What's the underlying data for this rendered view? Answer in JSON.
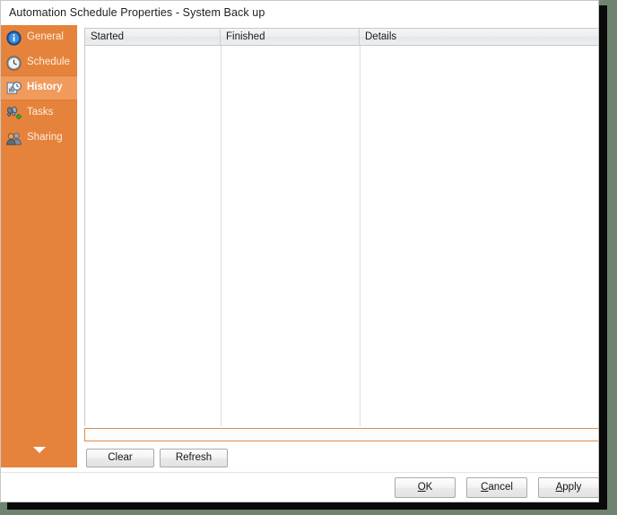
{
  "window": {
    "title": "Automation Schedule Properties - System Back up"
  },
  "sidebar": {
    "expander_icon": "chevron-down-icon",
    "items": [
      {
        "label": "General",
        "icon": "info-icon",
        "active": false
      },
      {
        "label": "Schedule",
        "icon": "clock-icon",
        "active": false
      },
      {
        "label": "History",
        "icon": "history-icon",
        "active": true
      },
      {
        "label": "Tasks",
        "icon": "tasks-icon",
        "active": false
      },
      {
        "label": "Sharing",
        "icon": "sharing-icon",
        "active": false
      }
    ]
  },
  "history_list": {
    "columns": [
      {
        "label": "Started"
      },
      {
        "label": "Finished"
      },
      {
        "label": "Details"
      }
    ],
    "rows": []
  },
  "actions": {
    "clear_label": "Clear",
    "refresh_label": "Refresh"
  },
  "footer": {
    "ok": {
      "accel": "O",
      "rest": "K"
    },
    "cancel": {
      "accel": "C",
      "rest": "ancel"
    },
    "apply": {
      "accel": "A",
      "rest": "pply"
    }
  },
  "colors": {
    "sidebar": "#e5833c",
    "sidebar_active": "#f09a5c",
    "sidebar_active_border": "#d97a33",
    "scroll_border": "#e08b46",
    "window_bg": "#ffffff",
    "desktop_bg": "#6f8470"
  }
}
